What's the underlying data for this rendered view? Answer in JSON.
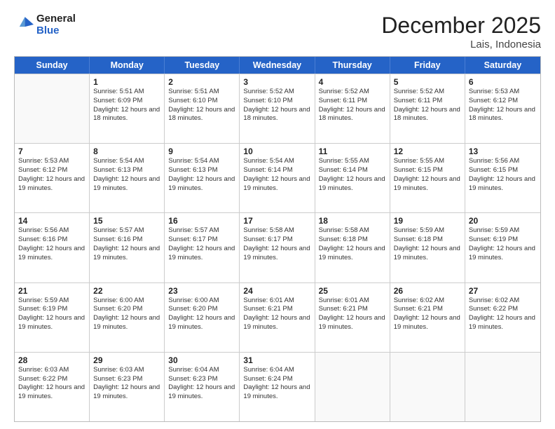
{
  "header": {
    "logo": {
      "general": "General",
      "blue": "Blue"
    },
    "title": "December 2025",
    "subtitle": "Lais, Indonesia"
  },
  "calendar": {
    "weekdays": [
      "Sunday",
      "Monday",
      "Tuesday",
      "Wednesday",
      "Thursday",
      "Friday",
      "Saturday"
    ],
    "weeks": [
      [
        {
          "day": "",
          "sunrise": "",
          "sunset": "",
          "daylight": "",
          "empty": true
        },
        {
          "day": "1",
          "sunrise": "Sunrise: 5:51 AM",
          "sunset": "Sunset: 6:09 PM",
          "daylight": "Daylight: 12 hours and 18 minutes."
        },
        {
          "day": "2",
          "sunrise": "Sunrise: 5:51 AM",
          "sunset": "Sunset: 6:10 PM",
          "daylight": "Daylight: 12 hours and 18 minutes."
        },
        {
          "day": "3",
          "sunrise": "Sunrise: 5:52 AM",
          "sunset": "Sunset: 6:10 PM",
          "daylight": "Daylight: 12 hours and 18 minutes."
        },
        {
          "day": "4",
          "sunrise": "Sunrise: 5:52 AM",
          "sunset": "Sunset: 6:11 PM",
          "daylight": "Daylight: 12 hours and 18 minutes."
        },
        {
          "day": "5",
          "sunrise": "Sunrise: 5:52 AM",
          "sunset": "Sunset: 6:11 PM",
          "daylight": "Daylight: 12 hours and 18 minutes."
        },
        {
          "day": "6",
          "sunrise": "Sunrise: 5:53 AM",
          "sunset": "Sunset: 6:12 PM",
          "daylight": "Daylight: 12 hours and 18 minutes."
        }
      ],
      [
        {
          "day": "7",
          "sunrise": "Sunrise: 5:53 AM",
          "sunset": "Sunset: 6:12 PM",
          "daylight": "Daylight: 12 hours and 19 minutes."
        },
        {
          "day": "8",
          "sunrise": "Sunrise: 5:54 AM",
          "sunset": "Sunset: 6:13 PM",
          "daylight": "Daylight: 12 hours and 19 minutes."
        },
        {
          "day": "9",
          "sunrise": "Sunrise: 5:54 AM",
          "sunset": "Sunset: 6:13 PM",
          "daylight": "Daylight: 12 hours and 19 minutes."
        },
        {
          "day": "10",
          "sunrise": "Sunrise: 5:54 AM",
          "sunset": "Sunset: 6:14 PM",
          "daylight": "Daylight: 12 hours and 19 minutes."
        },
        {
          "day": "11",
          "sunrise": "Sunrise: 5:55 AM",
          "sunset": "Sunset: 6:14 PM",
          "daylight": "Daylight: 12 hours and 19 minutes."
        },
        {
          "day": "12",
          "sunrise": "Sunrise: 5:55 AM",
          "sunset": "Sunset: 6:15 PM",
          "daylight": "Daylight: 12 hours and 19 minutes."
        },
        {
          "day": "13",
          "sunrise": "Sunrise: 5:56 AM",
          "sunset": "Sunset: 6:15 PM",
          "daylight": "Daylight: 12 hours and 19 minutes."
        }
      ],
      [
        {
          "day": "14",
          "sunrise": "Sunrise: 5:56 AM",
          "sunset": "Sunset: 6:16 PM",
          "daylight": "Daylight: 12 hours and 19 minutes."
        },
        {
          "day": "15",
          "sunrise": "Sunrise: 5:57 AM",
          "sunset": "Sunset: 6:16 PM",
          "daylight": "Daylight: 12 hours and 19 minutes."
        },
        {
          "day": "16",
          "sunrise": "Sunrise: 5:57 AM",
          "sunset": "Sunset: 6:17 PM",
          "daylight": "Daylight: 12 hours and 19 minutes."
        },
        {
          "day": "17",
          "sunrise": "Sunrise: 5:58 AM",
          "sunset": "Sunset: 6:17 PM",
          "daylight": "Daylight: 12 hours and 19 minutes."
        },
        {
          "day": "18",
          "sunrise": "Sunrise: 5:58 AM",
          "sunset": "Sunset: 6:18 PM",
          "daylight": "Daylight: 12 hours and 19 minutes."
        },
        {
          "day": "19",
          "sunrise": "Sunrise: 5:59 AM",
          "sunset": "Sunset: 6:18 PM",
          "daylight": "Daylight: 12 hours and 19 minutes."
        },
        {
          "day": "20",
          "sunrise": "Sunrise: 5:59 AM",
          "sunset": "Sunset: 6:19 PM",
          "daylight": "Daylight: 12 hours and 19 minutes."
        }
      ],
      [
        {
          "day": "21",
          "sunrise": "Sunrise: 5:59 AM",
          "sunset": "Sunset: 6:19 PM",
          "daylight": "Daylight: 12 hours and 19 minutes."
        },
        {
          "day": "22",
          "sunrise": "Sunrise: 6:00 AM",
          "sunset": "Sunset: 6:20 PM",
          "daylight": "Daylight: 12 hours and 19 minutes."
        },
        {
          "day": "23",
          "sunrise": "Sunrise: 6:00 AM",
          "sunset": "Sunset: 6:20 PM",
          "daylight": "Daylight: 12 hours and 19 minutes."
        },
        {
          "day": "24",
          "sunrise": "Sunrise: 6:01 AM",
          "sunset": "Sunset: 6:21 PM",
          "daylight": "Daylight: 12 hours and 19 minutes."
        },
        {
          "day": "25",
          "sunrise": "Sunrise: 6:01 AM",
          "sunset": "Sunset: 6:21 PM",
          "daylight": "Daylight: 12 hours and 19 minutes."
        },
        {
          "day": "26",
          "sunrise": "Sunrise: 6:02 AM",
          "sunset": "Sunset: 6:21 PM",
          "daylight": "Daylight: 12 hours and 19 minutes."
        },
        {
          "day": "27",
          "sunrise": "Sunrise: 6:02 AM",
          "sunset": "Sunset: 6:22 PM",
          "daylight": "Daylight: 12 hours and 19 minutes."
        }
      ],
      [
        {
          "day": "28",
          "sunrise": "Sunrise: 6:03 AM",
          "sunset": "Sunset: 6:22 PM",
          "daylight": "Daylight: 12 hours and 19 minutes."
        },
        {
          "day": "29",
          "sunrise": "Sunrise: 6:03 AM",
          "sunset": "Sunset: 6:23 PM",
          "daylight": "Daylight: 12 hours and 19 minutes."
        },
        {
          "day": "30",
          "sunrise": "Sunrise: 6:04 AM",
          "sunset": "Sunset: 6:23 PM",
          "daylight": "Daylight: 12 hours and 19 minutes."
        },
        {
          "day": "31",
          "sunrise": "Sunrise: 6:04 AM",
          "sunset": "Sunset: 6:24 PM",
          "daylight": "Daylight: 12 hours and 19 minutes."
        },
        {
          "day": "",
          "sunrise": "",
          "sunset": "",
          "daylight": "",
          "empty": true
        },
        {
          "day": "",
          "sunrise": "",
          "sunset": "",
          "daylight": "",
          "empty": true
        },
        {
          "day": "",
          "sunrise": "",
          "sunset": "",
          "daylight": "",
          "empty": true
        }
      ]
    ]
  }
}
